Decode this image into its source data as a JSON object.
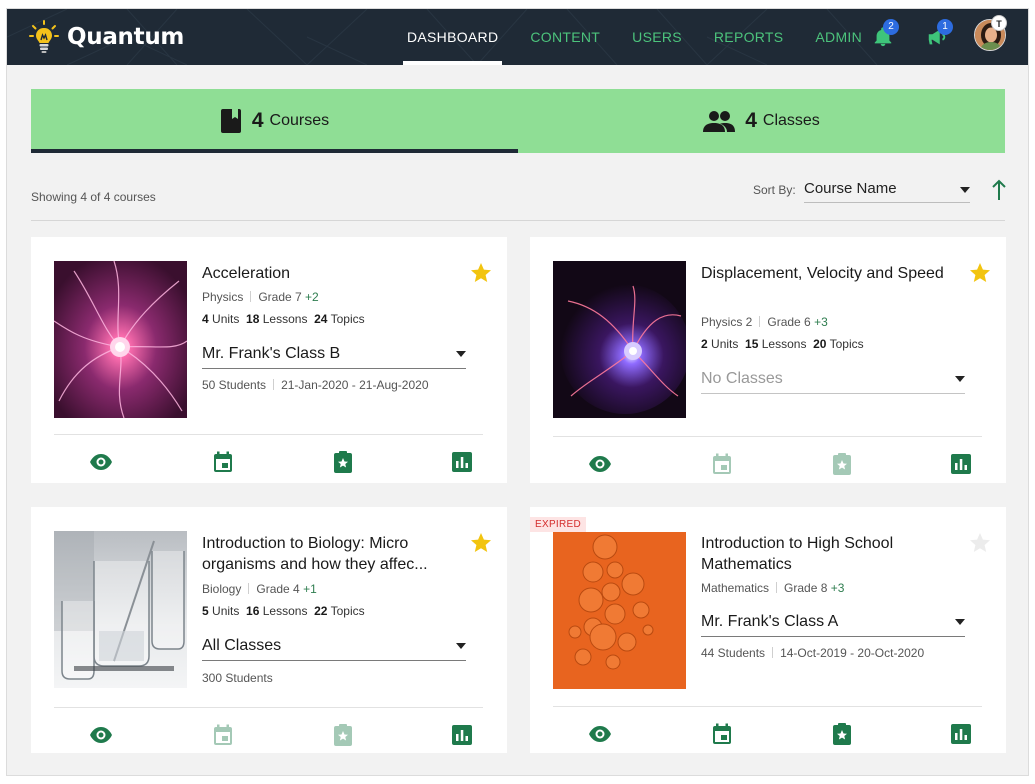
{
  "app": {
    "name": "Quantum"
  },
  "nav": {
    "items": [
      {
        "label": "DASHBOARD",
        "active": true
      },
      {
        "label": "CONTENT"
      },
      {
        "label": "USERS"
      },
      {
        "label": "REPORTS"
      },
      {
        "label": "ADMIN"
      }
    ],
    "notifications_badge": "2",
    "announcements_badge": "1",
    "avatar_badge": "T"
  },
  "tabs": [
    {
      "count": "4",
      "label": "Courses",
      "icon": "book-icon",
      "active": true
    },
    {
      "count": "4",
      "label": "Classes",
      "icon": "people-icon"
    }
  ],
  "list": {
    "showing": "Showing 4 of 4 courses",
    "sort_label": "Sort By:",
    "sort_value": "Course Name"
  },
  "courses": [
    {
      "title": "Acceleration",
      "subject": "Physics",
      "grade": "Grade 7",
      "grade_extra": "+2",
      "units": "4",
      "lessons": "18",
      "topics": "24",
      "units_label": "Units",
      "lessons_label": "Lessons",
      "topics_label": "Topics",
      "class": "Mr. Frank's Class B",
      "students": "50 Students",
      "dates": "21-Jan-2020 - 21-Aug-2020",
      "favorite": true
    },
    {
      "title": "Displacement, Velocity and Speed",
      "subject": "Physics 2",
      "grade": "Grade 6",
      "grade_extra": "+3",
      "units": "2",
      "lessons": "15",
      "topics": "20",
      "units_label": "Units",
      "lessons_label": "Lessons",
      "topics_label": "Topics",
      "class": "No Classes",
      "favorite": true
    },
    {
      "title": "Introduction to Biology: Micro organisms and how they affec...",
      "subject": "Biology",
      "grade": "Grade 4",
      "grade_extra": "+1",
      "units": "5",
      "lessons": "16",
      "topics": "22",
      "units_label": "Units",
      "lessons_label": "Lessons",
      "topics_label": "Topics",
      "class": "All Classes",
      "students": "300 Students",
      "favorite": true
    },
    {
      "title": "Introduction to High School Mathematics",
      "subject": "Mathematics",
      "grade": "Grade 8",
      "grade_extra": "+3",
      "class": "Mr. Frank's Class A",
      "students": "44 Students",
      "dates": "14-Oct-2019 - 20-Oct-2020",
      "favorite": false,
      "badge": "EXPIRED"
    }
  ],
  "colors": {
    "accent_green": "#1f7a4c",
    "tab_bg": "#8fde95",
    "topbar": "#1f2a36",
    "star": "#f2c40f",
    "expired": "#d42c2c"
  }
}
